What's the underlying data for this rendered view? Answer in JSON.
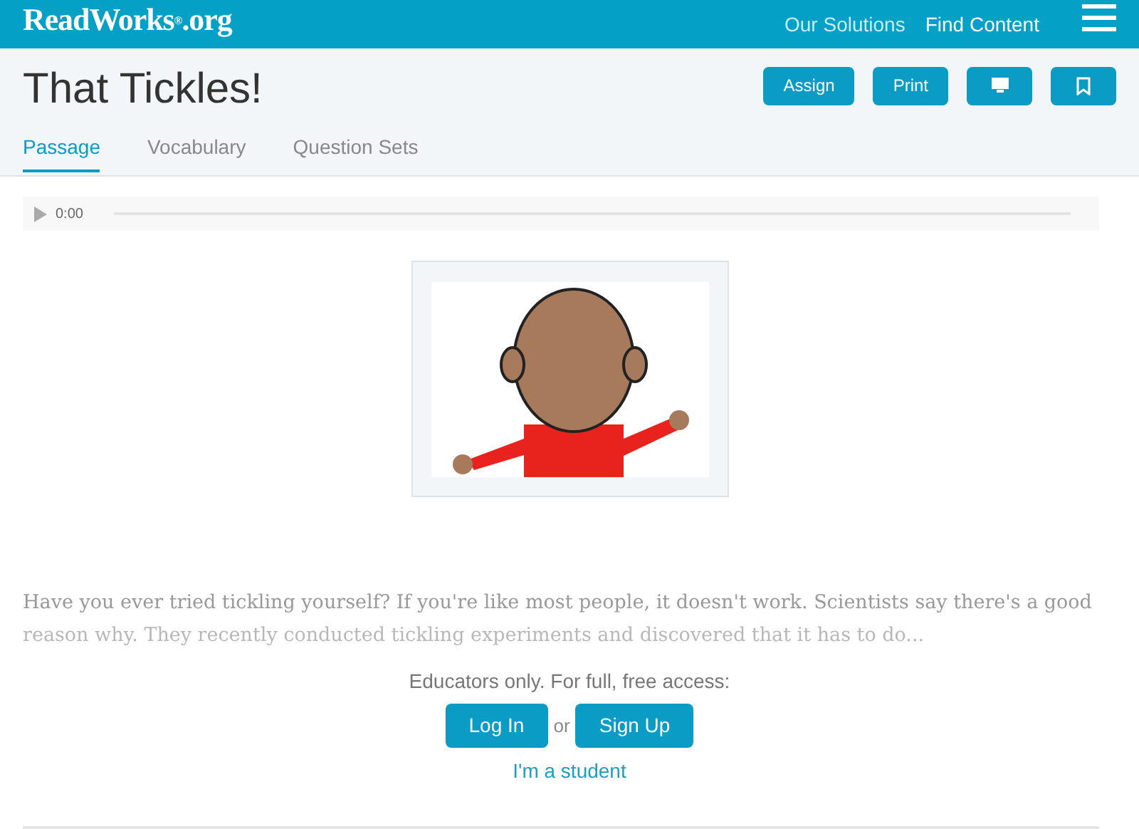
{
  "header": {
    "logo": "ReadWorks",
    "logo_suffix": ".org",
    "logo_mark": "®",
    "nav": [
      "Our Solutions",
      "Find Content"
    ]
  },
  "title": "That Tickles!",
  "actions": [
    {
      "kind": "text",
      "label": "Assign"
    },
    {
      "kind": "text",
      "label": "Print"
    },
    {
      "kind": "monitor"
    },
    {
      "kind": "bookmark"
    }
  ],
  "tabs": [
    {
      "label": "Passage",
      "selected": true
    },
    {
      "label": "Vocabulary",
      "selected": false
    },
    {
      "label": "Question Sets",
      "selected": false
    }
  ],
  "audio": {
    "time": "0:00"
  },
  "illustration": {
    "kind": "picture"
  },
  "passage": [
    "Have you ever tried tickling yourself? If you're like most people, it doesn't work. Scientists say there's a good",
    "reason why. They recently conducted tickling experiments and discovered that it has to do..."
  ],
  "access": {
    "prompt": "Educators only. For full, free access:",
    "login": "Log In",
    "or": "or",
    "signup": "Sign Up",
    "student": "I'm a student"
  }
}
